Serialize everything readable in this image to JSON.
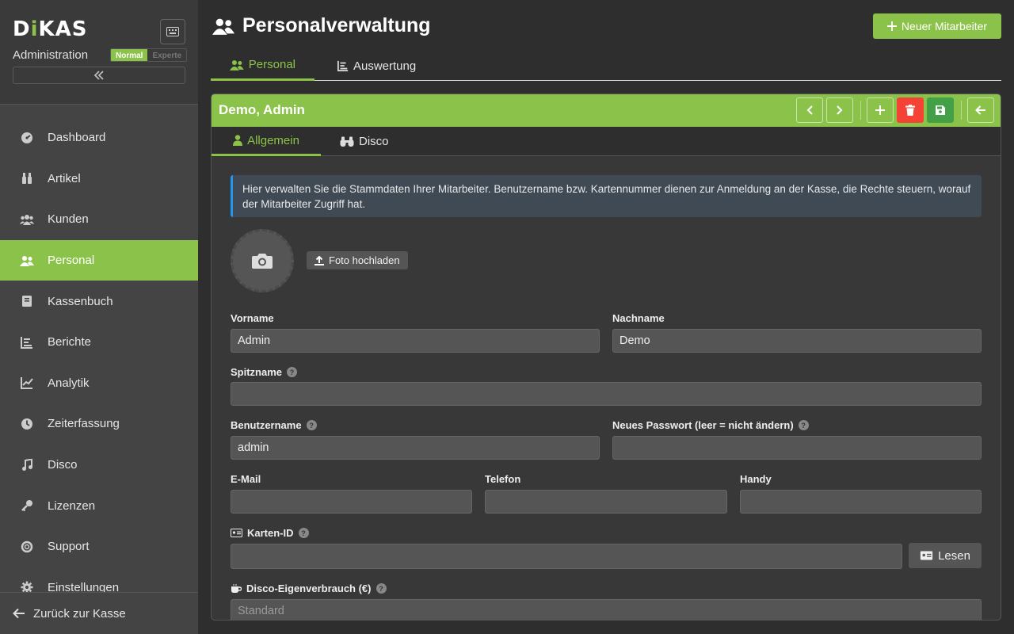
{
  "sidebar": {
    "logo_pre": "D",
    "logo_dot": "i",
    "logo_post": "KAS",
    "subtitle": "Administration",
    "mode_normal": "Normal",
    "mode_expert": "Experte",
    "items": [
      {
        "label": "Dashboard",
        "icon": "dashboard-icon"
      },
      {
        "label": "Artikel",
        "icon": "drinks-icon"
      },
      {
        "label": "Kunden",
        "icon": "users-icon"
      },
      {
        "label": "Personal",
        "icon": "staff-icon"
      },
      {
        "label": "Kassenbuch",
        "icon": "book-icon"
      },
      {
        "label": "Berichte",
        "icon": "report-icon"
      },
      {
        "label": "Analytik",
        "icon": "chart-line-icon"
      },
      {
        "label": "Zeiterfassung",
        "icon": "clock-icon"
      },
      {
        "label": "Disco",
        "icon": "music-icon"
      },
      {
        "label": "Lizenzen",
        "icon": "key-icon"
      },
      {
        "label": "Support",
        "icon": "lifebuoy-icon"
      },
      {
        "label": "Einstellungen",
        "icon": "gear-icon"
      }
    ],
    "footer": "Zurück zur Kasse"
  },
  "header": {
    "title": "Personalverwaltung",
    "new_button": "Neuer Mitarbeiter",
    "tabs": [
      "Personal",
      "Auswertung"
    ]
  },
  "card": {
    "title": "Demo, Admin",
    "tabs": [
      "Allgemein",
      "Disco"
    ],
    "info": "Hier verwalten Sie die Stammdaten Ihrer Mitarbeiter. Benutzername bzw. Kartennummer dienen zur Anmeldung an der Kasse, die Rechte steuern, worauf der Mitarbeiter Zugriff hat.",
    "upload": "Foto hochladen"
  },
  "form": {
    "vorname_label": "Vorname",
    "vorname_value": "Admin",
    "nachname_label": "Nachname",
    "nachname_value": "Demo",
    "spitzname_label": "Spitzname",
    "spitzname_value": "",
    "benutzername_label": "Benutzername",
    "benutzername_value": "admin",
    "passwort_label": "Neues Passwort (leer = nicht ändern)",
    "passwort_value": "",
    "email_label": "E-Mail",
    "telefon_label": "Telefon",
    "handy_label": "Handy",
    "karten_label": "Karten-ID",
    "karten_button": "Lesen",
    "disco_label": "Disco-Eigenverbrauch (€)",
    "disco_placeholder": "Standard"
  },
  "colors": {
    "accent": "#8bc34a",
    "danger": "#f44336",
    "save": "#43a047",
    "info_border": "#2196f3"
  }
}
